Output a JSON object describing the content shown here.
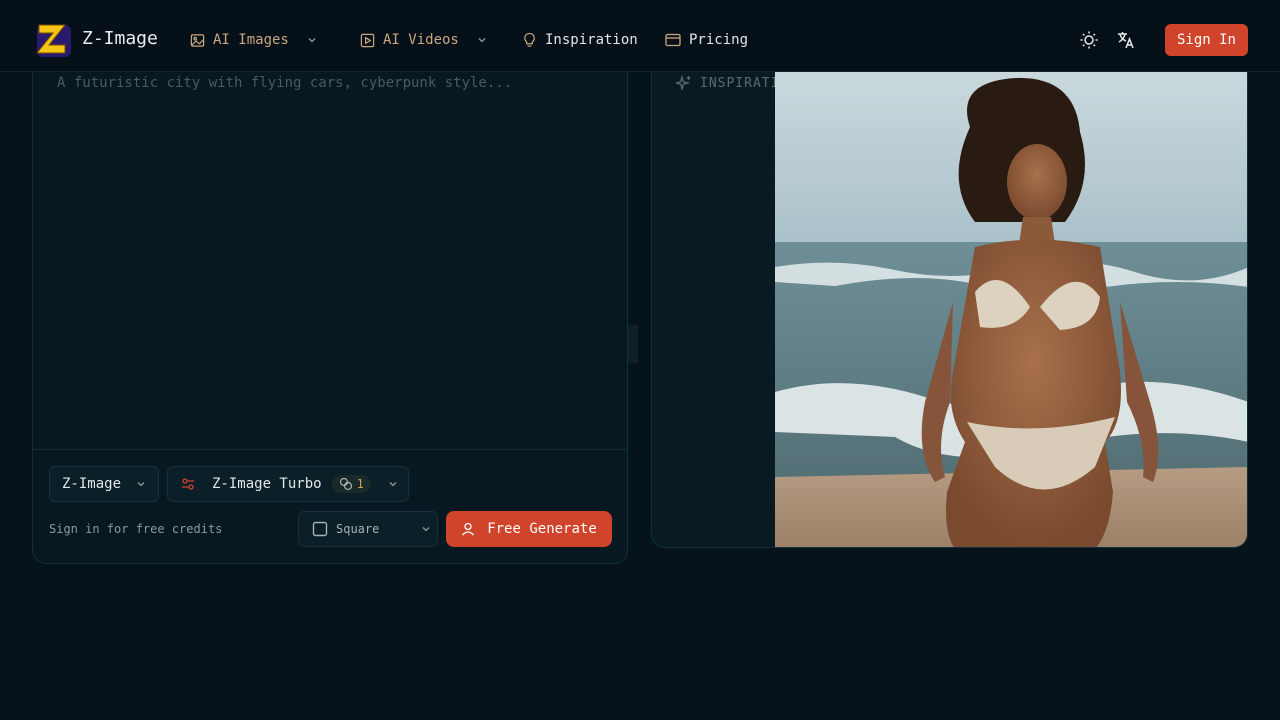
{
  "header": {
    "brand": "Z-Image",
    "nav": {
      "ai_images": "AI Images",
      "ai_videos": "AI Videos",
      "inspiration": "Inspiration",
      "pricing": "Pricing"
    },
    "sign_in": "Sign In",
    "icons": [
      "sun-icon",
      "translate-icon"
    ]
  },
  "generator": {
    "prompt_placeholder": "A futuristic city with flying cars, cyberpunk style...",
    "model_select": "Z-Image",
    "variant_select": "Z-Image Turbo",
    "credit_cost": "1",
    "signin_note": "Sign in for free credits",
    "aspect_ratio": "Square",
    "generate_label": "Free Generate"
  },
  "gallery": {
    "label": "INSPIRATION GALLERY"
  },
  "colors": {
    "accent": "#d1442c",
    "background": "#06131b",
    "panel": "#071820",
    "nav_muted": "#c9a780",
    "credit": "#d4a24a"
  }
}
